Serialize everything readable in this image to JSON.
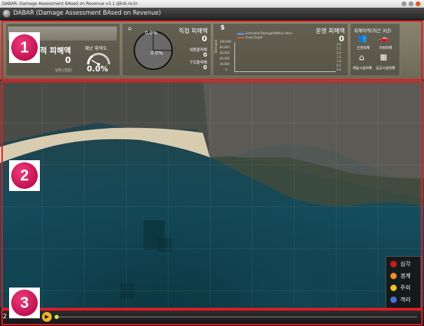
{
  "window": {
    "title": "DABAR: Damage Assessment BAsed on Revenue v3.1 @kdi.re.kr"
  },
  "app": {
    "title": "DABAR (Damage Assessment BAsed on Revenue)"
  },
  "panel1": {
    "title": "적 피해액",
    "value": "0",
    "unit": "단위 (천원)",
    "gauge_label": "재난 취약도",
    "gauge_value": "0.0%"
  },
  "panel2": {
    "pie_top": "0.0%",
    "pie_center": "0.0%",
    "title": "직접 피해액",
    "value": "0",
    "rows": [
      {
        "label": "내용물피해",
        "value": "0"
      },
      {
        "label": "구조물피해",
        "value": "0"
      }
    ]
  },
  "panel3": {
    "title": "운영 피해액",
    "value": "0",
    "ylabel": "Damaged",
    "legend": [
      "Estimated Damaged(Million Won)",
      "Flood Depth"
    ],
    "y_ticks": [
      "100,000",
      "80,000",
      "60,000",
      "40,000",
      "20,000",
      "0"
    ],
    "y2_ticks": [
      "3.0",
      "2.5",
      "2.0",
      "1.5",
      "1.0",
      "0.5",
      "0.0"
    ]
  },
  "panel4": {
    "title": "피해이력(최근 3년)",
    "items": [
      {
        "label": "인명피해"
      },
      {
        "label": "차량피해"
      },
      {
        "label": "재동시설피해"
      },
      {
        "label": "공공시설피해"
      }
    ]
  },
  "legend": {
    "items": [
      {
        "label": "심각",
        "color": "#d7191c"
      },
      {
        "label": "경계",
        "color": "#f08c2a"
      },
      {
        "label": "주의",
        "color": "#f5c21a"
      },
      {
        "label": "격리",
        "color": "#4a6fd8"
      }
    ]
  },
  "timeline": {
    "label": "2"
  },
  "annotations": [
    "1",
    "2",
    "3"
  ]
}
